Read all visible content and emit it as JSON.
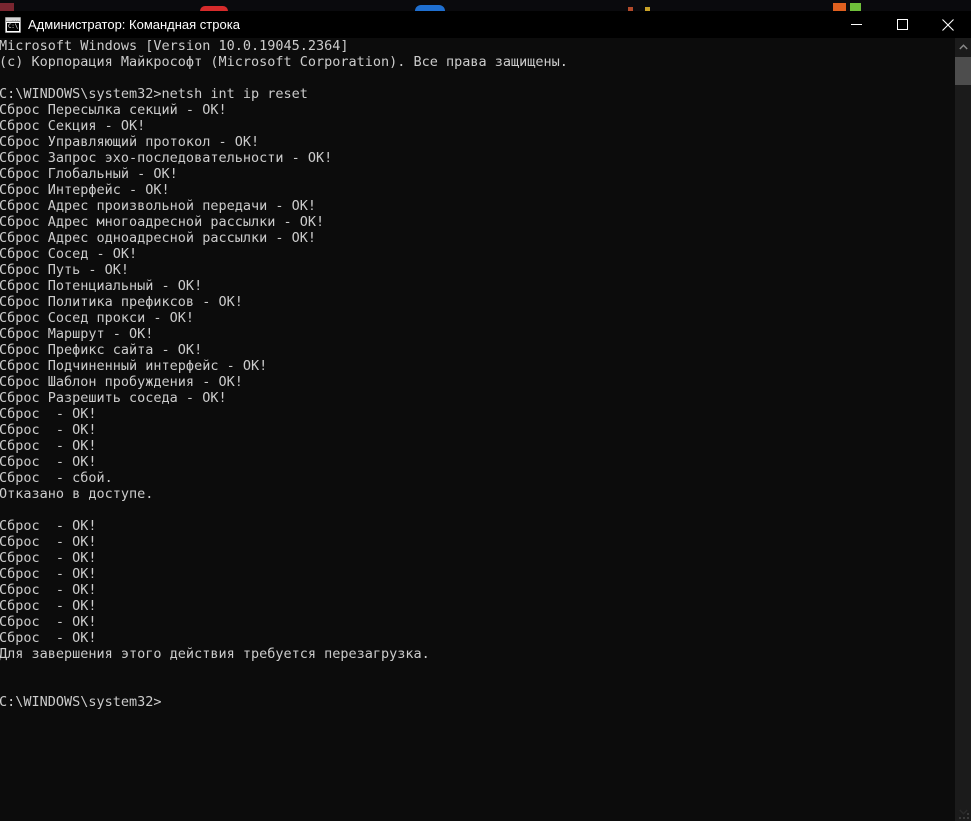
{
  "window": {
    "title": "Администратор: Командная строка",
    "icon_name": "cmd-console-icon",
    "icon_text": "C:\\.",
    "titlebar_bg": "#000000",
    "console_bg": "#0c0c0c",
    "text_color": "#cccccc",
    "controls": {
      "minimize_label": "Свернуть",
      "maximize_label": "Развернуть",
      "close_label": "Закрыть"
    }
  },
  "console": {
    "prompt_path": "C:\\WINDOWS\\system32>",
    "command": "netsh int ip reset",
    "lines": [
      "Microsoft Windows [Version 10.0.19045.2364]",
      "(c) Корпорация Майкрософт (Microsoft Corporation). Все права защищены.",
      "",
      "C:\\WINDOWS\\system32>netsh int ip reset",
      "Сброс Пересылка секций - OK!",
      "Сброс Секция - OK!",
      "Сброс Управляющий протокол - OK!",
      "Сброс Запрос эхо-последовательности - OK!",
      "Сброс Глобальный - OK!",
      "Сброс Интерфейс - OK!",
      "Сброс Адрес произвольной передачи - OK!",
      "Сброс Адрес многоадресной рассылки - OK!",
      "Сброс Адрес одноадресной рассылки - OK!",
      "Сброс Сосед - OK!",
      "Сброс Путь - OK!",
      "Сброс Потенциальный - OK!",
      "Сброс Политика префиксов - OK!",
      "Сброс Сосед прокси - OK!",
      "Сброс Маршрут - OK!",
      "Сброс Префикс сайта - OK!",
      "Сброс Подчиненный интерфейс - OK!",
      "Сброс Шаблон пробуждения - OK!",
      "Сброс Разрешить соседа - OK!",
      "Сброс  - OK!",
      "Сброс  - OK!",
      "Сброс  - OK!",
      "Сброс  - OK!",
      "Сброс  - сбой.",
      "Отказано в доступе.",
      "",
      "Сброс  - OK!",
      "Сброс  - OK!",
      "Сброс  - OK!",
      "Сброс  - OK!",
      "Сброс  - OK!",
      "Сброс  - OK!",
      "Сброс  - OK!",
      "Сброс  - OK!",
      "Для завершения этого действия требуется перезагрузка.",
      "",
      "",
      "C:\\WINDOWS\\system32>"
    ]
  },
  "scrollbar": {
    "up_arrow_name": "scroll-up-arrow",
    "down_arrow_name": "scroll-down-arrow",
    "thumb_name": "scroll-thumb"
  }
}
